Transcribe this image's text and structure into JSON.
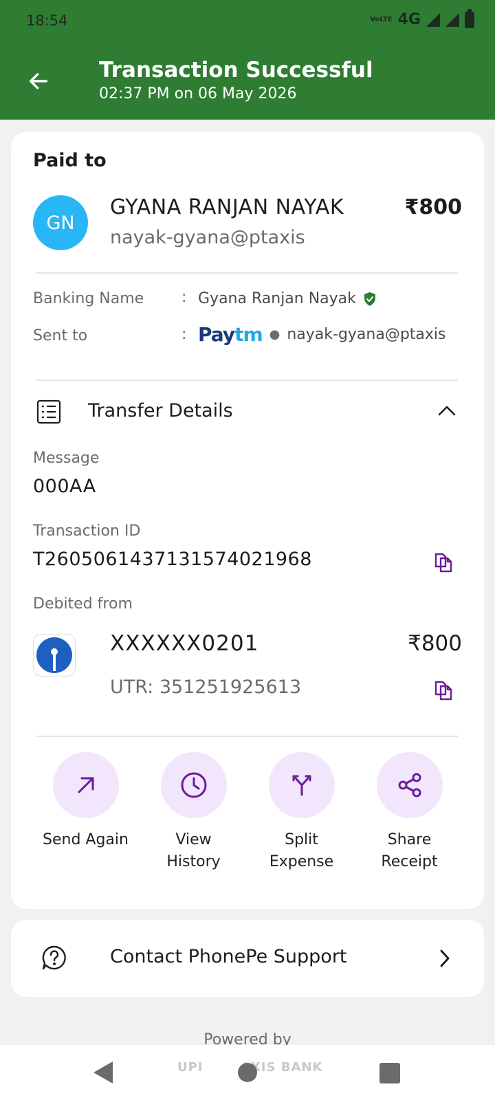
{
  "status_bar": {
    "time": "18:54",
    "volte": "VoLTE",
    "network": "4G"
  },
  "header": {
    "title": "Transaction Successful",
    "subtitle": "02:37 PM on 06 May 2026",
    "bg_color": "#2e7d32"
  },
  "payee": {
    "section_label": "Paid to",
    "initials": "GN",
    "name": "GYANA RANJAN NAYAK",
    "amount": "₹800",
    "vpa": "nayak-gyana@ptaxis"
  },
  "details": {
    "banking_name_label": "Banking Name",
    "banking_name_value": "Gyana Ranjan Nayak",
    "sent_to_label": "Sent to",
    "sent_to_brand_part1": "Pay",
    "sent_to_brand_part2": "tm",
    "sent_to_value": "nayak-gyana@ptaxis",
    "colon": ":"
  },
  "transfer": {
    "title": "Transfer Details",
    "message_label": "Message",
    "message_value": "000AA",
    "txn_label": "Transaction ID",
    "txn_value": "T2605061437131574021968",
    "debited_label": "Debited from",
    "account": "XXXXXX0201",
    "account_amount": "₹800",
    "utr": "UTR: 351251925613"
  },
  "actions": [
    {
      "label": "Send Again",
      "icon": "arrow-up-right-icon"
    },
    {
      "label": "View History",
      "icon": "clock-icon"
    },
    {
      "label": "Split Expense",
      "icon": "split-icon"
    },
    {
      "label": "Share Receipt",
      "icon": "share-icon"
    }
  ],
  "support": {
    "label": "Contact PhonePe Support"
  },
  "footer": {
    "powered_by": "Powered by",
    "bank1": "UPI",
    "bank2": "AXIS BANK"
  },
  "accent_color": "#6a1b9a"
}
